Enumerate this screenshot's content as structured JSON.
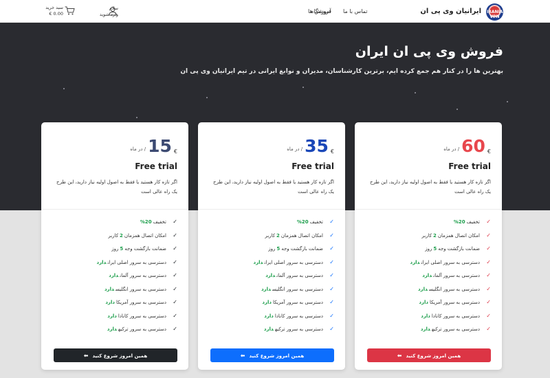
{
  "header": {
    "brand": "ایرانیان وی پی ان",
    "logo_text": "IRANIAN VPN",
    "nav": {
      "contact": "تماس با ما",
      "shop": "فروشگاه",
      "learn": "آموزش ها"
    },
    "user": {
      "greeting": "سلام",
      "login": "وارد شوید"
    },
    "cart": {
      "label": "سبد خرید",
      "amount": "€ 0.00"
    }
  },
  "hero": {
    "title": "فروش وی پی ان ایران",
    "subtitle": "بهترین ها را در کنار هم جمع کرده ایم، برترین کارشناسان، مدیران و نوابغ ایرانی در تیم ایرانیان وی پی ان"
  },
  "colors": {
    "dark_bg": "#2a2b30",
    "accent_red": "#dc3545",
    "accent_blue": "#0d6efd",
    "accent_dark": "#212529",
    "highlight": "#1c9e4b"
  },
  "plans": [
    {
      "currency": "€",
      "price": "15",
      "period": "/ در ماه",
      "color": "#3c4a72",
      "check_color": "#212529",
      "name": "Free trial",
      "description": "اگر تازه کار هستید یا فقط به اصول اولیه نیاز دارید، این طرح یک راه عالی است",
      "features": [
        {
          "pre": "تخفیف",
          "hl": "20%",
          "post": ""
        },
        {
          "pre": "امکان اتصال همزمان",
          "hl": "2",
          "post": "کاربر"
        },
        {
          "pre": "ضمانت بازگشت وجه",
          "hl": "5",
          "post": "روز"
        },
        {
          "pre": "دسترسی به سرور اصلی ایران",
          "hl": "دارد",
          "post": ""
        },
        {
          "pre": "دسترسی به سرور آلمان",
          "hl": "دارد",
          "post": ""
        },
        {
          "pre": "دسترسی به سرور انگلیس",
          "hl": "دارد",
          "post": ""
        },
        {
          "pre": "دسترسی به سرور آمریکا",
          "hl": "دارد",
          "post": ""
        },
        {
          "pre": "دسترسی به سرور کانادا",
          "hl": "دارد",
          "post": ""
        },
        {
          "pre": "دسترسی به سرور ترکیه",
          "hl": "دارد",
          "post": ""
        }
      ],
      "cta": "همین امروز شروع کنید",
      "cta_color": "#212529"
    },
    {
      "currency": "€",
      "price": "35",
      "period": "/ در ماه",
      "color": "#1a47b8",
      "check_color": "#0d6efd",
      "name": "Free trial",
      "description": "اگر تازه کار هستید یا فقط به اصول اولیه نیاز دارید، این طرح یک راه عالی است",
      "features": [
        {
          "pre": "تخفیف",
          "hl": "20%",
          "post": ""
        },
        {
          "pre": "امکان اتصال همزمان",
          "hl": "2",
          "post": "کاربر"
        },
        {
          "pre": "ضمانت بازگشت وجه",
          "hl": "5",
          "post": "روز"
        },
        {
          "pre": "دسترسی به سرور اصلی ایران",
          "hl": "دارد",
          "post": ""
        },
        {
          "pre": "دسترسی به سرور آلمان",
          "hl": "دارد",
          "post": ""
        },
        {
          "pre": "دسترسی به سرور انگلیس",
          "hl": "دارد",
          "post": ""
        },
        {
          "pre": "دسترسی به سرور آمریکا",
          "hl": "دارد",
          "post": ""
        },
        {
          "pre": "دسترسی به سرور کانادا",
          "hl": "دارد",
          "post": ""
        },
        {
          "pre": "دسترسی به سرور ترکیه",
          "hl": "دارد",
          "post": ""
        }
      ],
      "cta": "همین امروز شروع کنید",
      "cta_color": "#0d6efd"
    },
    {
      "currency": "€",
      "price": "60",
      "period": "/ در ماه",
      "color": "#e8474d",
      "check_color": "#dc3545",
      "name": "Free trial",
      "description": "اگر تازه کار هستید یا فقط به اصول اولیه نیاز دارید، این طرح یک راه عالی است",
      "features": [
        {
          "pre": "تخفیف",
          "hl": "20%",
          "post": ""
        },
        {
          "pre": "امکان اتصال همزمان",
          "hl": "2",
          "post": "کاربر"
        },
        {
          "pre": "ضمانت بازگشت وجه",
          "hl": "5",
          "post": "روز"
        },
        {
          "pre": "دسترسی به سرور اصلی ایران",
          "hl": "دارد",
          "post": ""
        },
        {
          "pre": "دسترسی به سرور آلمان",
          "hl": "دارد",
          "post": ""
        },
        {
          "pre": "دسترسی به سرور انگلیس",
          "hl": "دارد",
          "post": ""
        },
        {
          "pre": "دسترسی به سرور آمریکا",
          "hl": "دارد",
          "post": ""
        },
        {
          "pre": "دسترسی به سرور کانادا",
          "hl": "دارد",
          "post": ""
        },
        {
          "pre": "دسترسی به سرور ترکیه",
          "hl": "دارد",
          "post": ""
        }
      ],
      "cta": "همین امروز شروع کنید",
      "cta_color": "#dc3545"
    }
  ]
}
